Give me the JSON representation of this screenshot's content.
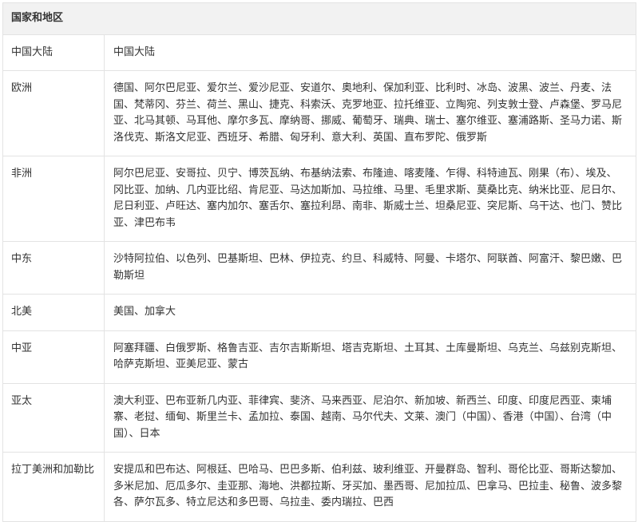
{
  "table": {
    "header": "国家和地区",
    "rows": [
      {
        "region": "中国大陆",
        "countries": "中国大陆"
      },
      {
        "region": "欧洲",
        "countries": "德国、阿尔巴尼亚、爱尔兰、爱沙尼亚、安道尔、奥地利、保加利亚、比利时、冰岛、波黑、波兰、丹麦、法国、梵蒂冈、芬兰、荷兰、黑山、捷克、科索沃、克罗地亚、拉托维亚、立陶宛、列支敦士登、卢森堡、罗马尼亚、北马其顿、马耳他、摩尔多瓦、摩纳哥、挪威、葡萄牙、瑞典、瑞士、塞尔维亚、塞浦路斯、圣马力诺、斯洛伐克、斯洛文尼亚、西班牙、希腊、匈牙利、意大利、英国、直布罗陀、俄罗斯"
      },
      {
        "region": "非洲",
        "countries": "阿尔巴尼亚、安哥拉、贝宁、博茨瓦纳、布基纳法索、布隆迪、喀麦隆、乍得、科特迪瓦、刚果（布）、埃及、冈比亚、加纳、几内亚比绍、肯尼亚、马达加斯加、马拉维、马里、毛里求斯、莫桑比克、纳米比亚、尼日尔、尼日利亚、卢旺达、塞内加尔、塞舌尔、塞拉利昂、南非、斯威士兰、坦桑尼亚、突尼斯、乌干达、也门、赞比亚、津巴布韦"
      },
      {
        "region": "中东",
        "countries": "沙特阿拉伯、以色列、巴基斯坦、巴林、伊拉克、约旦、科威特、阿曼、卡塔尔、阿联酋、阿富汗、黎巴嫩、巴勒斯坦"
      },
      {
        "region": "北美",
        "countries": "美国、加拿大"
      },
      {
        "region": "中亚",
        "countries": "阿塞拜疆、白俄罗斯、格鲁吉亚、吉尔吉斯斯坦、塔吉克斯坦、土耳其、土库曼斯坦、乌克兰、乌兹别克斯坦、哈萨克斯坦、亚美尼亚、蒙古"
      },
      {
        "region": "亚太",
        "countries": "澳大利亚、巴布亚新几内亚、菲律宾、斐济、马来西亚、尼泊尔、新加坡、新西兰、印度、印度尼西亚、柬埔寨、老挝、缅甸、斯里兰卡、孟加拉、泰国、越南、马尔代夫、文莱、澳门（中国）、香港（中国）、台湾（中国）、日本"
      },
      {
        "region": "拉丁美洲和加勒比",
        "countries": "安提瓜和巴布达、阿根廷、巴哈马、巴巴多斯、伯利兹、玻利维亚、开曼群岛、智利、哥伦比亚、哥斯达黎加、多米尼加、厄瓜多尔、圭亚那、海地、洪都拉斯、牙买加、墨西哥、尼加拉瓜、巴拿马、巴拉圭、秘鲁、波多黎各、萨尔瓦多、特立尼达和多巴哥、乌拉圭、委内瑞拉、巴西"
      }
    ]
  }
}
